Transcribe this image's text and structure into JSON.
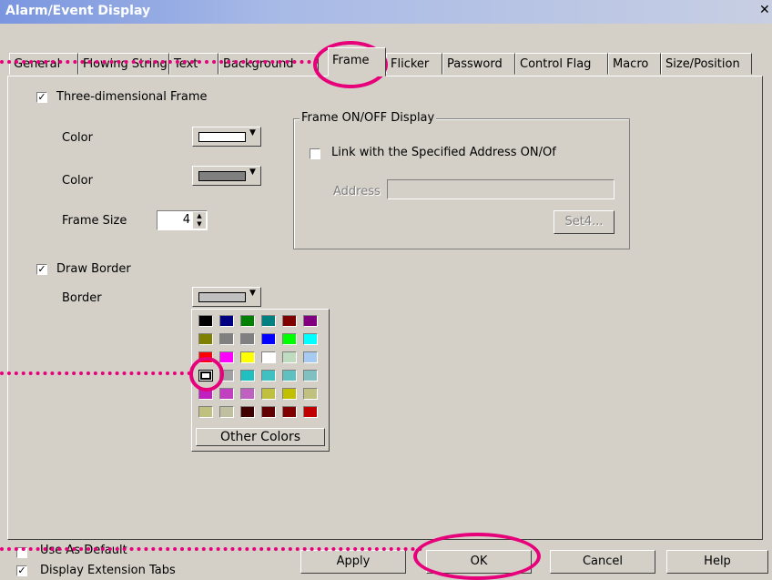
{
  "window": {
    "title": "Alarm/Event Display",
    "close": "✕"
  },
  "tabs": [
    {
      "label": "General"
    },
    {
      "label": "Flowing String"
    },
    {
      "label": "Text"
    },
    {
      "label": "Background"
    },
    {
      "label": "Frame"
    },
    {
      "label": "Flicker"
    },
    {
      "label": "Password"
    },
    {
      "label": "Control Flag"
    },
    {
      "label": "Macro"
    },
    {
      "label": "Size/Position"
    }
  ],
  "frame": {
    "three_d_checkbox_label": "Three-dimensional Frame",
    "three_d_checked": true,
    "color1_label": "Color",
    "color1_value": "#ffffff",
    "color2_label": "Color",
    "color2_value": "#808080",
    "frame_size_label": "Frame Size",
    "frame_size_value": "4",
    "draw_border_label": "Draw Border",
    "draw_border_checked": true,
    "border_label": "Border",
    "border_value": "#c0c0c0"
  },
  "onoff": {
    "group_label": "Frame ON/OFF Display",
    "link_label": "Link with the Specified Address ON/Of",
    "link_checked": false,
    "address_label": "Address",
    "address_value": "",
    "set_button": "Set4..."
  },
  "palette": {
    "colors": [
      [
        "#000000",
        "#000080",
        "#008000",
        "#008080",
        "#800000",
        "#800080"
      ],
      [
        "#808000",
        "#808080",
        "#808080",
        "#0000ff",
        "#00ff00",
        "#00ffff"
      ],
      [
        "#ff0000",
        "#ff00ff",
        "#ffff00",
        "#ffffff",
        "#c0dcc0",
        "#a6caf0"
      ],
      [
        "#ffffff",
        "#a0a0a4",
        "#20c0c0",
        "#40c0c0",
        "#60c0c0",
        "#80c0c0"
      ],
      [
        "#c020c0",
        "#c040c0",
        "#c060c0",
        "#c0c040",
        "#c0c000",
        "#c0c080"
      ],
      [
        "#c0c080",
        "#c0c0a0",
        "#400000",
        "#600000",
        "#800000",
        "#c00000"
      ]
    ],
    "selected": "3-0",
    "other_colors": "Other Colors"
  },
  "footer": {
    "use_as_default": "Use As Default",
    "use_as_default_checked": false,
    "display_ext_tabs": "Display Extension Tabs",
    "display_ext_tabs_checked": true,
    "apply": "Apply",
    "ok": "OK",
    "cancel": "Cancel",
    "help": "Help"
  },
  "colors": {
    "highlight": "#e6007a",
    "title_bar": "#7a96df"
  }
}
